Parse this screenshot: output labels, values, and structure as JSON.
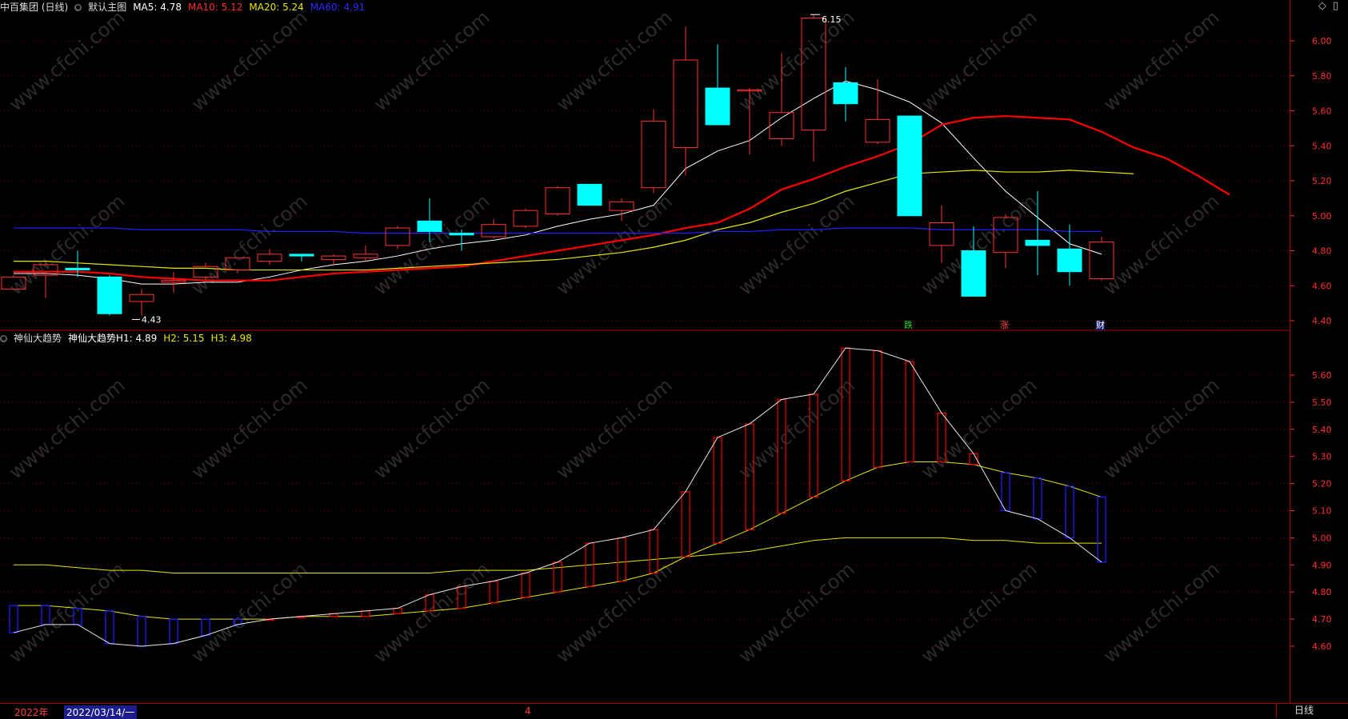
{
  "main_header": {
    "stock": "中百集团 (日线)",
    "template": "默认主图",
    "ma5": "MA5: 4.78",
    "ma10": "MA10: 5.12",
    "ma20": "MA20: 5.24",
    "ma60": "MA60: 4.91"
  },
  "sub_header": {
    "indicator": "神仙大趋势",
    "h1": "神仙大趋势H1: 4.89",
    "h2": "H2: 5.15",
    "h3": "H3: 4.98"
  },
  "annotations": {
    "high": "6.15",
    "low": "4.43"
  },
  "event_tags": {
    "fall": "跌",
    "rise": "涨",
    "finance": "财"
  },
  "bottom": {
    "year": "2022年",
    "date": "2022/03/14/一",
    "month": "4",
    "period": "日线"
  },
  "watermark": "www.cfchi.com",
  "colors": {
    "up": "#ff3232",
    "down": "#00ffff",
    "ma5": "#ffffff",
    "ma10": "#ff0000",
    "ma20": "#e6e600",
    "ma60": "#2020ff",
    "grid": "#7a0000",
    "axis": "#ff3030"
  },
  "chart_data": [
    {
      "type": "candlestick",
      "title": "中百集团 (日线)",
      "ylim": [
        4.35,
        6.18
      ],
      "yticks": [
        "6.00",
        "5.80",
        "5.60",
        "5.40",
        "5.20",
        "5.00",
        "4.80",
        "4.60",
        "4.40"
      ],
      "candles": [
        {
          "o": 4.58,
          "h": 4.66,
          "l": 4.58,
          "c": 4.65
        },
        {
          "o": 4.66,
          "h": 4.73,
          "l": 4.53,
          "c": 4.72
        },
        {
          "o": 4.7,
          "h": 4.8,
          "l": 4.65,
          "c": 4.69
        },
        {
          "o": 4.65,
          "h": 4.66,
          "l": 4.43,
          "c": 4.44
        },
        {
          "o": 4.51,
          "h": 4.58,
          "l": 4.43,
          "c": 4.55
        },
        {
          "o": 4.62,
          "h": 4.68,
          "l": 4.56,
          "c": 4.63
        },
        {
          "o": 4.65,
          "h": 4.73,
          "l": 4.63,
          "c": 4.71
        },
        {
          "o": 4.69,
          "h": 4.76,
          "l": 4.67,
          "c": 4.76
        },
        {
          "o": 4.74,
          "h": 4.81,
          "l": 4.72,
          "c": 4.78
        },
        {
          "o": 4.78,
          "h": 4.78,
          "l": 4.74,
          "c": 4.77
        },
        {
          "o": 4.75,
          "h": 4.78,
          "l": 4.72,
          "c": 4.77
        },
        {
          "o": 4.76,
          "h": 4.83,
          "l": 4.74,
          "c": 4.78
        },
        {
          "o": 4.83,
          "h": 4.94,
          "l": 4.81,
          "c": 4.93
        },
        {
          "o": 4.97,
          "h": 5.1,
          "l": 4.85,
          "c": 4.91
        },
        {
          "o": 4.9,
          "h": 4.92,
          "l": 4.8,
          "c": 4.89
        },
        {
          "o": 4.88,
          "h": 4.98,
          "l": 4.87,
          "c": 4.95
        },
        {
          "o": 4.94,
          "h": 5.04,
          "l": 4.93,
          "c": 5.03
        },
        {
          "o": 5.01,
          "h": 5.17,
          "l": 5.0,
          "c": 5.16
        },
        {
          "o": 5.18,
          "h": 5.18,
          "l": 5.06,
          "c": 5.06
        },
        {
          "o": 5.03,
          "h": 5.1,
          "l": 4.97,
          "c": 5.08
        },
        {
          "o": 5.16,
          "h": 5.61,
          "l": 5.13,
          "c": 5.54
        },
        {
          "o": 5.39,
          "h": 6.08,
          "l": 5.23,
          "c": 5.89
        },
        {
          "o": 5.73,
          "h": 5.98,
          "l": 5.52,
          "c": 5.52
        },
        {
          "o": 5.72,
          "h": 5.73,
          "l": 5.35,
          "c": 5.72
        },
        {
          "o": 5.44,
          "h": 5.93,
          "l": 5.4,
          "c": 5.59
        },
        {
          "o": 5.49,
          "h": 6.15,
          "l": 5.31,
          "c": 6.13
        },
        {
          "o": 5.76,
          "h": 5.85,
          "l": 5.54,
          "c": 5.64
        },
        {
          "o": 5.42,
          "h": 5.78,
          "l": 5.41,
          "c": 5.55
        },
        {
          "o": 5.57,
          "h": 5.57,
          "l": 5.0,
          "c": 5.0
        },
        {
          "o": 4.83,
          "h": 5.06,
          "l": 4.73,
          "c": 4.96
        },
        {
          "o": 4.8,
          "h": 4.94,
          "l": 4.54,
          "c": 4.54
        },
        {
          "o": 4.79,
          "h": 5.01,
          "l": 4.7,
          "c": 4.99
        },
        {
          "o": 4.86,
          "h": 5.14,
          "l": 4.66,
          "c": 4.83
        },
        {
          "o": 4.81,
          "h": 4.95,
          "l": 4.6,
          "c": 4.68
        },
        {
          "o": 4.64,
          "h": 4.88,
          "l": 4.63,
          "c": 4.85
        }
      ],
      "series": [
        {
          "name": "MA5",
          "values": [
            4.67,
            4.67,
            4.66,
            4.64,
            4.61,
            4.61,
            4.62,
            4.62,
            4.65,
            4.69,
            4.72,
            4.74,
            4.77,
            4.81,
            4.84,
            4.86,
            4.89,
            4.94,
            4.98,
            5.01,
            5.06,
            5.27,
            5.37,
            5.43,
            5.56,
            5.67,
            5.77,
            5.72,
            5.65,
            5.53,
            5.33,
            5.14,
            4.99,
            4.84,
            4.78
          ]
        },
        {
          "name": "MA10",
          "values": [
            4.68,
            4.68,
            4.68,
            4.67,
            4.65,
            4.64,
            4.63,
            4.63,
            4.63,
            4.65,
            4.67,
            4.68,
            4.69,
            4.7,
            4.71,
            4.74,
            4.77,
            4.8,
            4.83,
            4.86,
            4.89,
            4.93,
            4.96,
            5.04,
            5.15,
            5.21,
            5.28,
            5.34,
            5.41,
            5.52,
            5.56,
            5.57,
            5.56,
            5.55,
            5.48,
            5.39,
            5.33,
            5.23,
            5.12
          ]
        },
        {
          "name": "MA20",
          "values": [
            4.74,
            4.74,
            4.73,
            4.72,
            4.71,
            4.7,
            4.7,
            4.69,
            4.69,
            4.69,
            4.69,
            4.69,
            4.7,
            4.71,
            4.72,
            4.73,
            4.74,
            4.75,
            4.77,
            4.79,
            4.82,
            4.86,
            4.92,
            4.96,
            5.02,
            5.07,
            5.14,
            5.19,
            5.24,
            5.25,
            5.26,
            5.25,
            5.25,
            5.26,
            5.25,
            5.24
          ]
        },
        {
          "name": "MA60",
          "values": [
            4.93,
            4.93,
            4.93,
            4.93,
            4.92,
            4.92,
            4.92,
            4.92,
            4.91,
            4.91,
            4.91,
            4.9,
            4.9,
            4.9,
            4.9,
            4.9,
            4.9,
            4.9,
            4.9,
            4.9,
            4.9,
            4.9,
            4.91,
            4.91,
            4.92,
            4.92,
            4.93,
            4.93,
            4.93,
            4.92,
            4.92,
            4.92,
            4.92,
            4.91,
            4.91
          ]
        }
      ]
    },
    {
      "type": "indicator",
      "title": "神仙大趋势",
      "ylim": [
        4.58,
        5.76
      ],
      "yticks": [
        "5.60",
        "5.50",
        "5.40",
        "5.30",
        "5.20",
        "5.10",
        "5.00",
        "4.90",
        "4.80",
        "4.70",
        "4.60"
      ],
      "series": [
        {
          "name": "H1",
          "values": [
            4.65,
            4.68,
            4.68,
            4.61,
            4.6,
            4.61,
            4.64,
            4.68,
            4.7,
            4.71,
            4.72,
            4.73,
            4.74,
            4.79,
            4.82,
            4.84,
            4.87,
            4.91,
            4.98,
            5.0,
            5.03,
            5.17,
            5.37,
            5.42,
            5.51,
            5.53,
            5.7,
            5.69,
            5.65,
            5.46,
            5.31,
            5.1,
            5.07,
            5.0,
            4.91,
            4.89
          ]
        },
        {
          "name": "H2",
          "values": [
            4.75,
            4.75,
            4.74,
            4.73,
            4.71,
            4.7,
            4.7,
            4.7,
            4.7,
            4.71,
            4.71,
            4.71,
            4.72,
            4.73,
            4.74,
            4.76,
            4.78,
            4.8,
            4.82,
            4.84,
            4.87,
            4.93,
            4.98,
            5.03,
            5.09,
            5.15,
            5.21,
            5.26,
            5.28,
            5.28,
            5.27,
            5.24,
            5.22,
            5.19,
            5.15
          ]
        },
        {
          "name": "H3",
          "values": [
            4.9,
            4.9,
            4.89,
            4.88,
            4.88,
            4.87,
            4.87,
            4.87,
            4.87,
            4.87,
            4.87,
            4.87,
            4.87,
            4.87,
            4.88,
            4.88,
            4.88,
            4.89,
            4.9,
            4.91,
            4.92,
            4.93,
            4.94,
            4.95,
            4.97,
            4.99,
            5.0,
            5.0,
            5.0,
            5.0,
            4.99,
            4.99,
            4.98,
            4.98,
            4.98
          ]
        }
      ]
    }
  ]
}
